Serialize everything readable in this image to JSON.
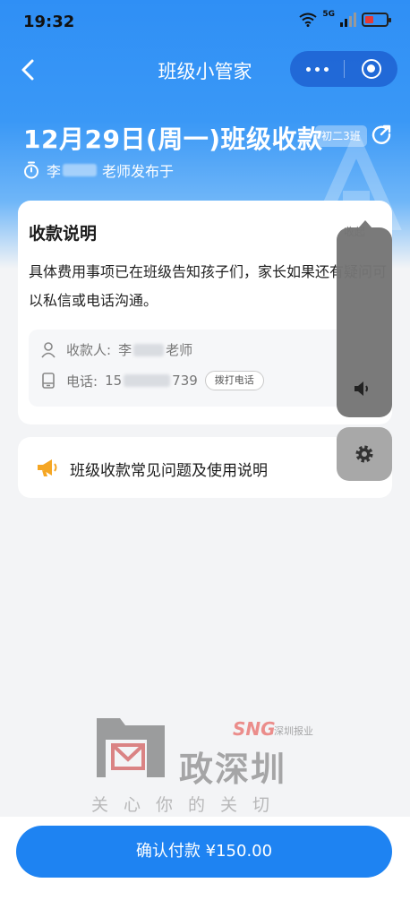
{
  "status_bar": {
    "time": "19:32",
    "network": "5G"
  },
  "nav": {
    "title": "班级小管家"
  },
  "header": {
    "title": "12月29日(周一)班级收款",
    "class_tag": "初二3班",
    "publisher_prefix": "李",
    "publisher_suffix": "老师发布于"
  },
  "payment_card": {
    "heading": "收款说明",
    "collapse_label": "收起",
    "description": "具体费用事项已在班级告知孩子们，家长如果还有疑问可以私信或电话沟通。",
    "payee_label": "收款人:",
    "payee_prefix": "李",
    "payee_suffix": "老师",
    "phone_label": "电话:",
    "phone_prefix": "15",
    "phone_suffix": "739",
    "call_button": "拨打电话"
  },
  "faq": {
    "label": "班级收款常见问题及使用说明"
  },
  "watermark": {
    "sng": "SNG",
    "sng_sub": "深圳报业",
    "brand": "政深圳",
    "slogan": "关心你的关切"
  },
  "footer": {
    "pay_button": "确认付款 ¥150.00"
  },
  "colors": {
    "primary": "#1e83f2",
    "header_blue": "#2f8ff5",
    "page_bg": "#f3f4f6",
    "accent_orange": "#f5a623"
  },
  "icons": [
    "back-arrow-icon",
    "more-dots-icon",
    "target-icon",
    "share-icon",
    "timer-icon",
    "person-icon",
    "phone-icon",
    "megaphone-icon",
    "volume-icon",
    "gear-icon",
    "wifi-icon",
    "signal-icon",
    "battery-icon"
  ]
}
